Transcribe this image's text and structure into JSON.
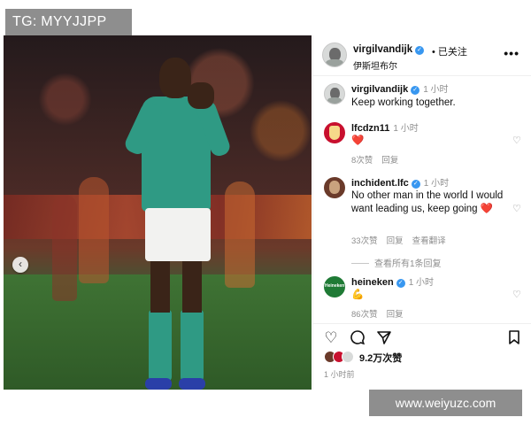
{
  "watermarks": {
    "top": "TG: MYYJJPP",
    "bottom": "www.weiyuzc.com"
  },
  "post": {
    "username": "virgilvandijk",
    "follow_status": "已关注",
    "location": "伊斯坦布尔",
    "more_icon": "more-horizontal-icon"
  },
  "comments": [
    {
      "username": "virgilvandijk",
      "verified": true,
      "time": "1 小时",
      "text": "Keep working together."
    },
    {
      "username": "lfcdzn11",
      "verified": false,
      "time": "1 小时",
      "text": "❤️",
      "likes": "8次赞",
      "reply": "回复"
    },
    {
      "username": "inchident.lfc",
      "verified": true,
      "time": "1 小时",
      "text": "No other man in the world I would want leading us, keep going ❤️",
      "likes": "33次赞",
      "reply": "回复",
      "translate": "查看翻译",
      "view_replies": "查看所有1条回复"
    },
    {
      "username": "heineken",
      "verified": true,
      "time": "1 小时",
      "text": "💪",
      "likes": "86次赞",
      "reply": "回复",
      "avatar_text": "Heineken"
    }
  ],
  "actions": {
    "like_icon": "heart-icon",
    "comment_icon": "comment-icon",
    "share_icon": "send-icon",
    "save_icon": "bookmark-icon",
    "likes_count": "9.2万次赞",
    "posted_time": "1 小时前"
  },
  "colors": {
    "verified": "#3897f0",
    "muted": "#8e8e8e",
    "heart": "#ed4956",
    "jersey": "#2f9a84"
  }
}
